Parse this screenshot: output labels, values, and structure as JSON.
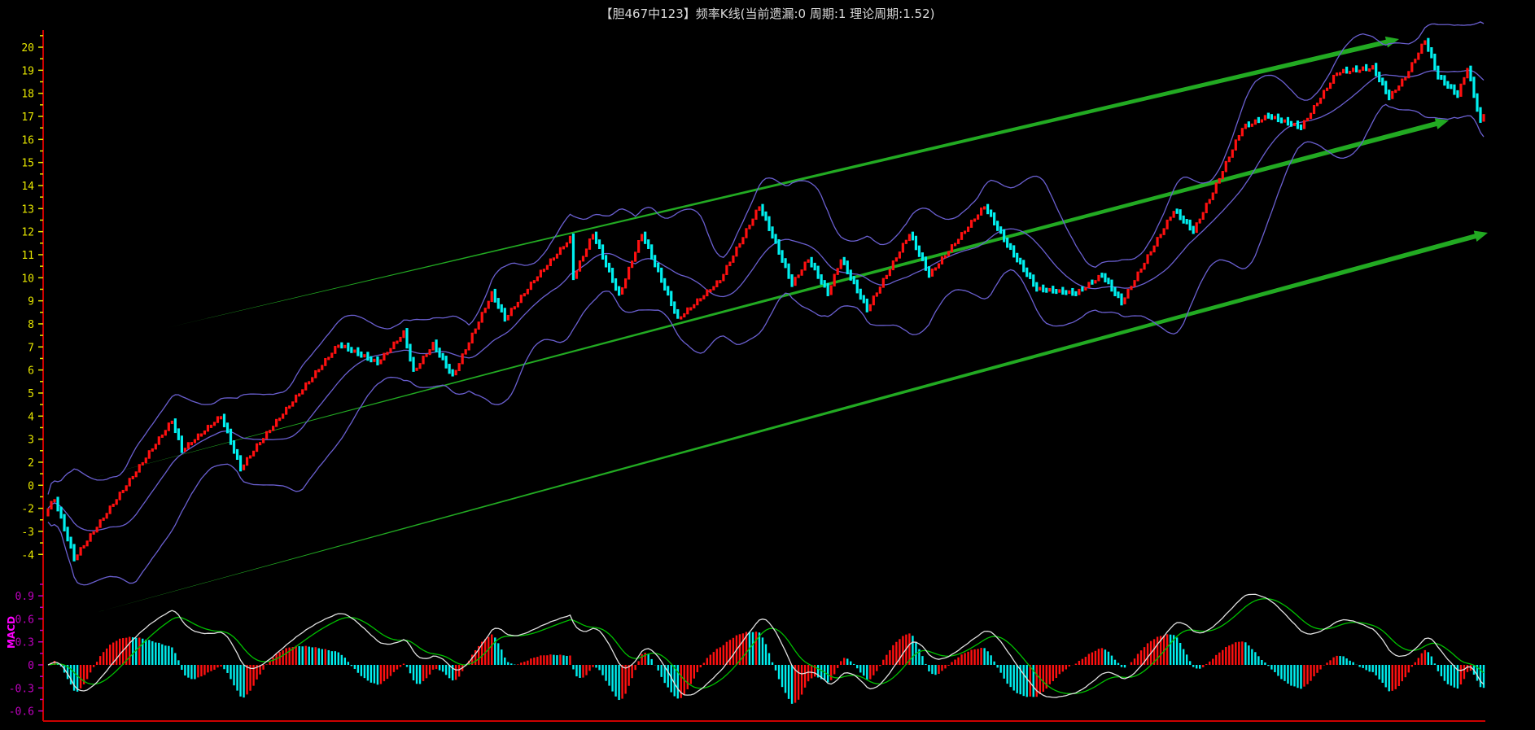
{
  "title": "【胆467中123】频率K线(当前遗漏:0 周期:1 理论周期:1.52)",
  "macd_name": "MACD",
  "chart_data": {
    "type": "candlestick",
    "title": "【胆467中123】频率K线(当前遗漏:0 周期:1 理论周期:1.52)",
    "y_tick_labels": [
      "20",
      "19",
      "18",
      "17",
      "16",
      "15",
      "14",
      "13",
      "12",
      "11",
      "10",
      "9",
      "8",
      "7",
      "6",
      "5",
      "4",
      "3",
      "2",
      "0",
      "-2",
      "-3",
      "-4"
    ],
    "bar_count": 441,
    "pivots": [
      [
        0,
        0
      ],
      [
        2,
        0.4
      ],
      [
        8,
        -2.2
      ],
      [
        38,
        3.8
      ],
      [
        41,
        2.5
      ],
      [
        53,
        4
      ],
      [
        59,
        1.7
      ],
      [
        64,
        2.7
      ],
      [
        89,
        7.1
      ],
      [
        101,
        6.3
      ],
      [
        109,
        7.6
      ],
      [
        112,
        5.9
      ],
      [
        118,
        7.1
      ],
      [
        124,
        5.7
      ],
      [
        136,
        9.3
      ],
      [
        140,
        8.2
      ],
      [
        149,
        9.9
      ],
      [
        160,
        11.7
      ],
      [
        161,
        10
      ],
      [
        167,
        11.9
      ],
      [
        175,
        9.2
      ],
      [
        182,
        11.9
      ],
      [
        193,
        8.2
      ],
      [
        206,
        9.9
      ],
      [
        218,
        13.1
      ],
      [
        222,
        11.8
      ],
      [
        228,
        9.7
      ],
      [
        233,
        10.8
      ],
      [
        239,
        9.3
      ],
      [
        243,
        10.8
      ],
      [
        251,
        8.6
      ],
      [
        264,
        11.9
      ],
      [
        270,
        10.1
      ],
      [
        287,
        13.1
      ],
      [
        294,
        11.4
      ],
      [
        303,
        9.5
      ],
      [
        315,
        9.3
      ],
      [
        323,
        10.1
      ],
      [
        329,
        8.9
      ],
      [
        345,
        12.9
      ],
      [
        351,
        12
      ],
      [
        357,
        13.7
      ],
      [
        366,
        16.5
      ],
      [
        374,
        17
      ],
      [
        384,
        16.5
      ],
      [
        395,
        18.9
      ],
      [
        406,
        19.1
      ],
      [
        411,
        17.8
      ],
      [
        416,
        18.7
      ],
      [
        422,
        20.3
      ],
      [
        426,
        18.7
      ],
      [
        432,
        17.9
      ],
      [
        435,
        19.1
      ],
      [
        439,
        16.7
      ],
      [
        440,
        17.1
      ]
    ],
    "bollinger": {
      "period": 20,
      "k": 2
    },
    "macd": {
      "fast": 12,
      "slow": 26,
      "signal": 9,
      "tick_labels": [
        "0.9",
        "0.6",
        "0.3",
        "0",
        "-0.3",
        "-0.6"
      ],
      "tick_values": [
        0.9,
        0.6,
        0.3,
        0,
        -0.3,
        -0.6
      ]
    },
    "colors": {
      "up": "#ff1010",
      "down": "#00f0f0",
      "band": "#6a5fd0",
      "dif": "#e0e0e0",
      "dea": "#00c000",
      "trend": "#22aa22",
      "axis": "#cc0000"
    }
  }
}
